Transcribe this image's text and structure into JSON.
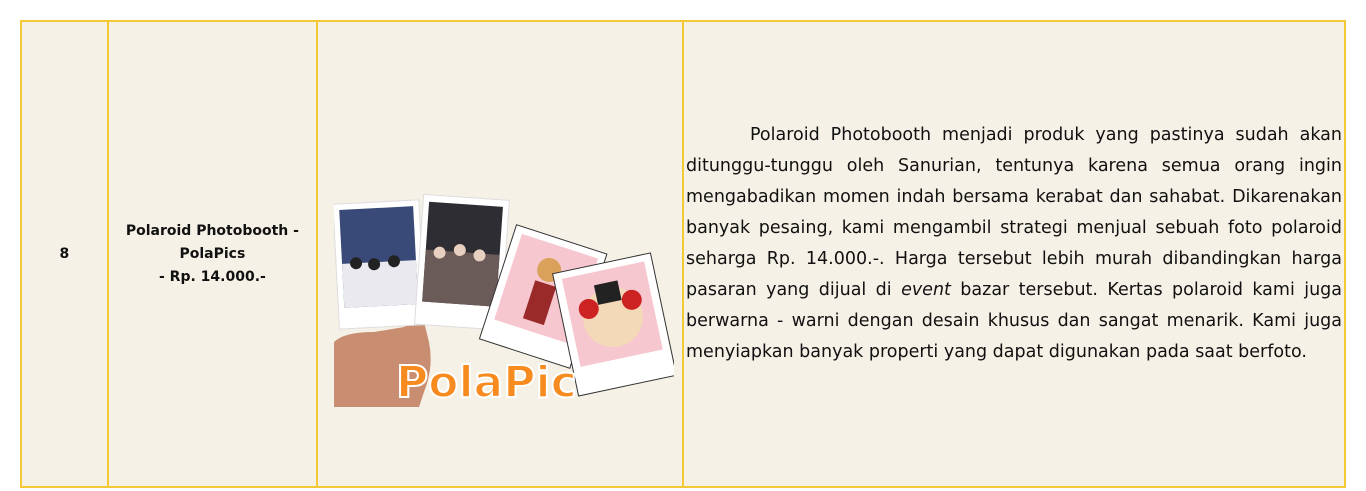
{
  "row": {
    "number": "8",
    "product_name_line1": "Polaroid Photobooth -",
    "product_name_line2": "PolaPics",
    "product_price": "- Rp. 14.000.-",
    "image_logo_text": "PolaPic",
    "description": {
      "part1": "Polaroid Photobooth menjadi produk yang pastinya sudah akan ditunggu-tunggu oleh Sanurian, tentunya karena semua orang ingin mengabadikan momen indah bersama kerabat dan sahabat. Dikarenakan banyak pesaing, kami mengambil strategi menjual sebuah foto polaroid seharga Rp. 14.000.-. Harga tersebut lebih murah dibandingkan harga pasaran yang dijual di ",
      "emphasis": "event",
      "part2": " bazar tersebut. Kertas polaroid kami juga berwarna - warni dengan desain khusus dan sangat menarik. Kami juga menyiapkan banyak properti yang dapat digunakan pada saat berfoto."
    }
  },
  "colors": {
    "border": "#f3c936",
    "background": "#f6f1e6",
    "logo_orange": "#f78b1f"
  }
}
